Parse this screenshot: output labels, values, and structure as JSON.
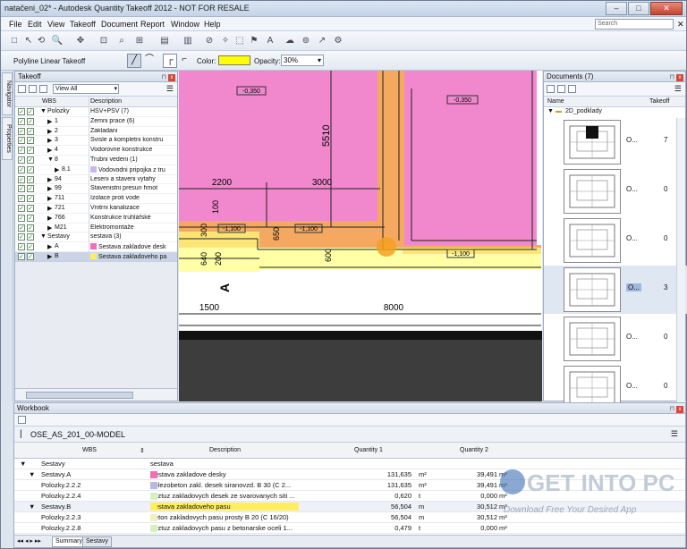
{
  "window": {
    "title": "natačeni_02* - Autodesk Quantity Takeoff 2012 - NOT FOR RESALE"
  },
  "menu": {
    "items": [
      "File",
      "Edit",
      "View",
      "Takeoff",
      "Document",
      "Report",
      "Window",
      "Help"
    ],
    "search_placeholder": "Search"
  },
  "toolbar2": {
    "mode_label": "Polyline Linear Takeoff",
    "color_label": "Color:",
    "color_value": "#ffff00",
    "opacity_label": "Opacity:",
    "opacity_value": "30%"
  },
  "sidetabs": {
    "navigator": "Navigator",
    "properties": "Properties"
  },
  "takeoff": {
    "title": "Takeoff",
    "view_filter": "View All",
    "col_wbs": "WBS",
    "col_desc": "Description",
    "rows": [
      {
        "indent": 0,
        "arrow": "▼",
        "wbs": "Polozky",
        "desc": "HSV+PSV (7)",
        "swatch": ""
      },
      {
        "indent": 1,
        "arrow": "▶",
        "wbs": "1",
        "desc": "Zemni prace (6)",
        "swatch": ""
      },
      {
        "indent": 1,
        "arrow": "▶",
        "wbs": "2",
        "desc": "Zakladani",
        "swatch": ""
      },
      {
        "indent": 1,
        "arrow": "▶",
        "wbs": "3",
        "desc": "Svisle a kompletni konstru",
        "swatch": ""
      },
      {
        "indent": 1,
        "arrow": "▶",
        "wbs": "4",
        "desc": "Vodorovne konstrukce",
        "swatch": ""
      },
      {
        "indent": 1,
        "arrow": "▼",
        "wbs": "8",
        "desc": "Trubni vedeni (1)",
        "swatch": ""
      },
      {
        "indent": 2,
        "arrow": "▶",
        "wbs": "8.1",
        "desc": "Vodovodni pripojka z tru",
        "swatch": "#c8b8e8"
      },
      {
        "indent": 1,
        "arrow": "▶",
        "wbs": "94",
        "desc": "Leseni a staveni vytahy",
        "swatch": ""
      },
      {
        "indent": 1,
        "arrow": "▶",
        "wbs": "99",
        "desc": "Stavenistni presun hmot",
        "swatch": ""
      },
      {
        "indent": 1,
        "arrow": "▶",
        "wbs": "711",
        "desc": "Izolace proti vode",
        "swatch": ""
      },
      {
        "indent": 1,
        "arrow": "▶",
        "wbs": "721",
        "desc": "Vnitrni kanalizace",
        "swatch": ""
      },
      {
        "indent": 1,
        "arrow": "▶",
        "wbs": "766",
        "desc": "Konstrukce truhlářské",
        "swatch": ""
      },
      {
        "indent": 1,
        "arrow": "▶",
        "wbs": "M21",
        "desc": "Elektromontaže",
        "swatch": ""
      },
      {
        "indent": 0,
        "arrow": "▼",
        "wbs": "Sestavy",
        "desc": "sestava (3)",
        "swatch": ""
      },
      {
        "indent": 1,
        "arrow": "▶",
        "wbs": "A",
        "desc": "Sestava zakladove desk",
        "swatch": "#f070b8"
      },
      {
        "indent": 1,
        "arrow": "▶",
        "wbs": "B",
        "desc": "Sestava zakladoveho pa",
        "swatch": "#ffee60"
      }
    ]
  },
  "drawing": {
    "levels": [
      "-0,350",
      "-0,350",
      "-1,100",
      "-1,100",
      "-1,100"
    ],
    "dims": [
      "5510",
      "2200",
      "3000",
      "100",
      "650",
      "300",
      "640",
      "200",
      "600",
      "1500",
      "8000"
    ],
    "section": "A"
  },
  "documents": {
    "title": "Documents (7)",
    "col_name": "Name",
    "col_takeoff": "Takeoff",
    "folder": "2D_podklady",
    "items": [
      {
        "name": "O...",
        "count": "7"
      },
      {
        "name": "O...",
        "count": "0"
      },
      {
        "name": "O...",
        "count": "0"
      },
      {
        "name": "O...",
        "count": "3"
      },
      {
        "name": "O...",
        "count": "0"
      },
      {
        "name": "O...",
        "count": "0"
      }
    ]
  },
  "workbook": {
    "title": "Workbook",
    "model": "OSE_AS_201_00-MODEL",
    "cols": {
      "wbs": "WBS",
      "desc": "Description",
      "q1": "Quantity 1",
      "q2": "Quantity 2"
    },
    "rows": [
      {
        "lvl": 0,
        "arrow": "▼",
        "wbs": "Sestavy",
        "desc": "sestava",
        "q1": "",
        "u1": "",
        "q2": "",
        "u2": "",
        "swatch": "",
        "sel": false
      },
      {
        "lvl": 1,
        "arrow": "▼",
        "wbs": "Sestavy.A",
        "desc": "Sestava zakladove desky",
        "q1": "131,635",
        "u1": "m²",
        "q2": "39,491",
        "u2": "m³",
        "swatch": "#f070b8",
        "sel": false
      },
      {
        "lvl": 2,
        "arrow": "",
        "wbs": "Polozky.2.2.2",
        "desc": "Zelezobeton zakl. desek siranovzd. B 30 (C 2...",
        "q1": "131,635",
        "u1": "m²",
        "q2": "39,491",
        "u2": "m³",
        "swatch": "#b8b8e8",
        "sel": false
      },
      {
        "lvl": 2,
        "arrow": "",
        "wbs": "Polozky.2.2.4",
        "desc": "Vyztuz zakladovych desek ze svarovanych siti ...",
        "q1": "0,620",
        "u1": "t",
        "q2": "0,000",
        "u2": "m²",
        "swatch": "#d8f0c0",
        "sel": false
      },
      {
        "lvl": 1,
        "arrow": "▼",
        "wbs": "Sestavy.B",
        "desc": "Sestava zakladoveho pasu",
        "q1": "56,504",
        "u1": "m",
        "q2": "30,512",
        "u2": "m³",
        "swatch": "#ffee60",
        "sel": true
      },
      {
        "lvl": 2,
        "arrow": "",
        "wbs": "Polozky.2.2.3",
        "desc": "Beton zakladovych pasu prosty B 20 (C 16/20)",
        "q1": "56,504",
        "u1": "m",
        "q2": "30,512",
        "u2": "m³",
        "swatch": "#f0f0c0",
        "sel": false
      },
      {
        "lvl": 2,
        "arrow": "",
        "wbs": "Polozky.2.2.8",
        "desc": "Vyztuz zakladovych pasu z betonarske oceli 1...",
        "q1": "0,479",
        "u1": "t",
        "q2": "0,000",
        "u2": "m²",
        "swatch": "#d8f0c0",
        "sel": false
      }
    ],
    "tabs": [
      "Summary",
      "Sestavy"
    ]
  },
  "watermark": {
    "title": "GET INTO PC",
    "subtitle": "Download Free Your Desired App"
  }
}
